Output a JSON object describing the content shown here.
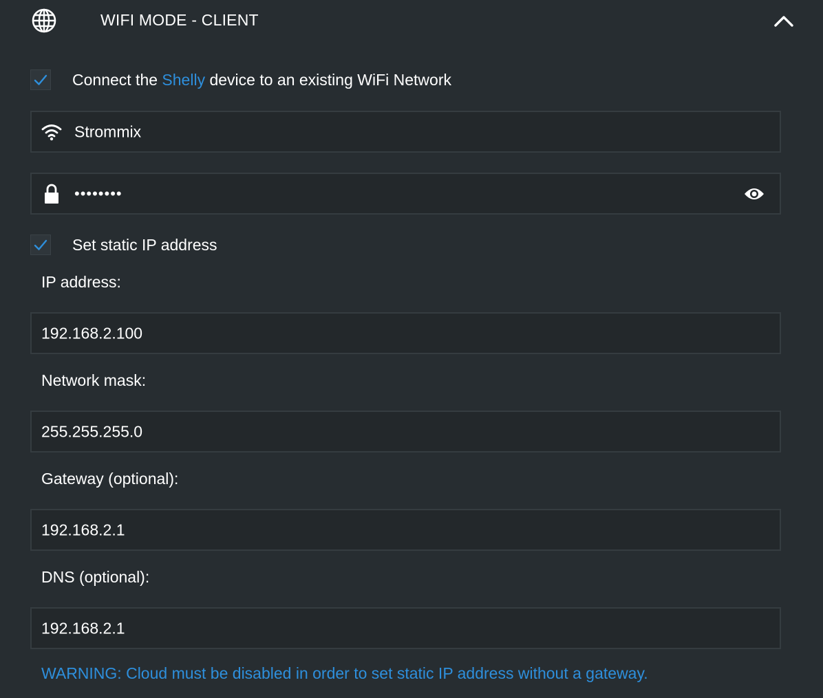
{
  "header": {
    "title": "WIFI MODE - CLIENT",
    "left_icon": "globe-icon",
    "right_icon": "chevron-up-icon"
  },
  "connect_option": {
    "checked": true,
    "label_before": "Connect the ",
    "label_brand": "Shelly",
    "label_after": " device to an existing WiFi Network"
  },
  "ssid_field": {
    "icon": "wifi-icon",
    "value": "Strommix"
  },
  "password_field": {
    "icon": "lock-icon",
    "value": "••••••••",
    "toggle_icon": "eye-icon"
  },
  "static_ip_option": {
    "checked": true,
    "label": "Set static IP address"
  },
  "ip_address": {
    "label": "IP address:",
    "value": "192.168.2.100"
  },
  "network_mask": {
    "label": "Network mask:",
    "value": "255.255.255.0"
  },
  "gateway": {
    "label": "Gateway (optional):",
    "value": "192.168.2.1"
  },
  "dns": {
    "label": "DNS (optional):",
    "value": "192.168.2.1"
  },
  "warning": "WARNING: Cloud must be disabled in order to set static IP address without a gateway.",
  "colors": {
    "background": "#272d31",
    "field_background": "#23282b",
    "accent": "#2e8fdc",
    "text": "#ffffff"
  }
}
